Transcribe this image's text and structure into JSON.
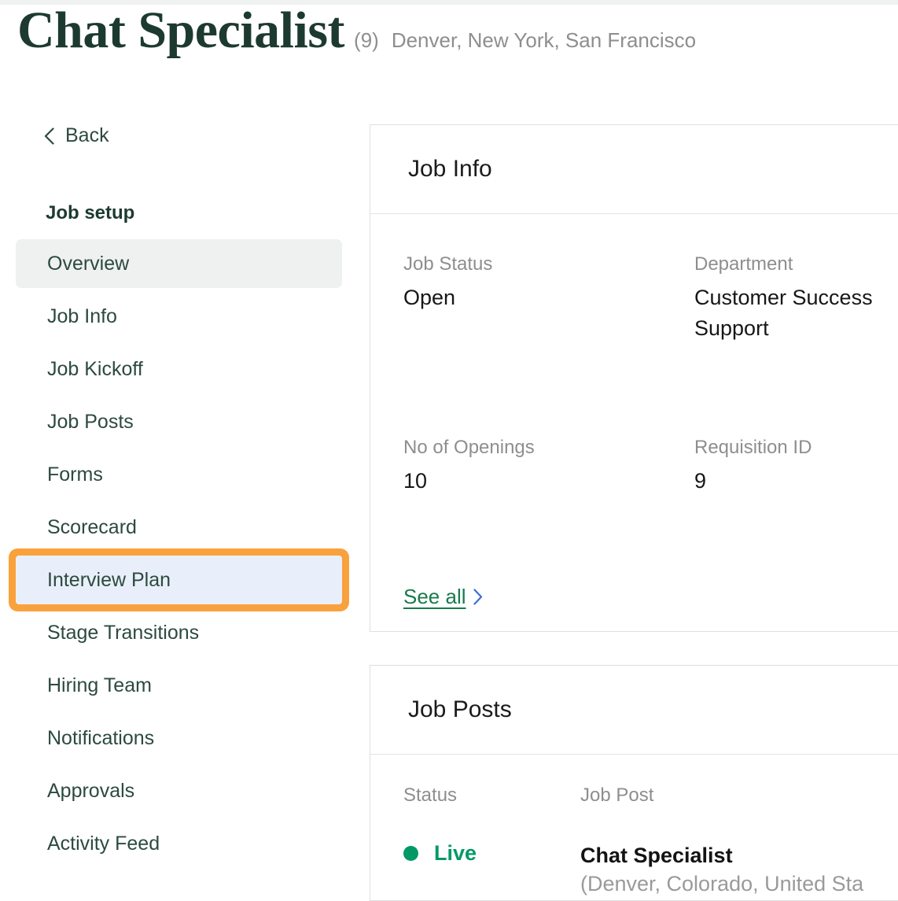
{
  "header": {
    "title": "Chat Specialist",
    "count": "(9)",
    "locations": "Denver, New York, San Francisco"
  },
  "sidebar": {
    "back_label": "Back",
    "section_heading": "Job setup",
    "items": [
      {
        "label": "Overview",
        "state": "active"
      },
      {
        "label": "Job Info",
        "state": "default"
      },
      {
        "label": "Job Kickoff",
        "state": "default"
      },
      {
        "label": "Job Posts",
        "state": "default"
      },
      {
        "label": "Forms",
        "state": "default"
      },
      {
        "label": "Scorecard",
        "state": "default"
      },
      {
        "label": "Interview Plan",
        "state": "focused"
      },
      {
        "label": "Stage Transitions",
        "state": "default"
      },
      {
        "label": "Hiring Team",
        "state": "default"
      },
      {
        "label": "Notifications",
        "state": "default"
      },
      {
        "label": "Approvals",
        "state": "default"
      },
      {
        "label": "Activity Feed",
        "state": "default"
      }
    ]
  },
  "job_info_card": {
    "title": "Job Info",
    "fields": [
      {
        "label": "Job Status",
        "value": "Open"
      },
      {
        "label": "Department",
        "value": "Customer Success Support"
      },
      {
        "label": "No of Openings",
        "value": "10"
      },
      {
        "label": "Requisition ID",
        "value": "9"
      }
    ],
    "see_all_label": "See all"
  },
  "job_posts_card": {
    "title": "Job Posts",
    "columns": [
      "Status",
      "Job Post"
    ],
    "rows": [
      {
        "status": "Live",
        "post_name": "Chat Specialist",
        "post_location": "(Denver, Colorado, United Sta"
      }
    ]
  },
  "colors": {
    "brand_green": "#1d3a30",
    "accent_orange": "#f9a13c",
    "link_green": "#1a7a4c",
    "chevron_blue": "#3b6fd4",
    "status_live": "#009966"
  }
}
